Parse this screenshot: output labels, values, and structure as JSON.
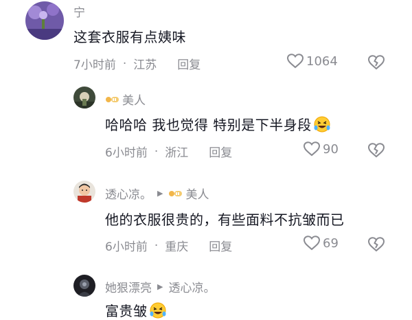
{
  "comments": [
    {
      "username": "宁",
      "text": "这套衣服有点姨味",
      "time": "7小时前",
      "location": "江苏",
      "reply_label": "回复",
      "likes": "1064"
    },
    {
      "username": "美人",
      "text": "哈哈哈 我也觉得 特别是下半身段",
      "time": "6小时前",
      "location": "浙江",
      "reply_label": "回复",
      "likes": "90"
    },
    {
      "username": "透心凉。",
      "reply_to": "美人",
      "text": "他的衣服很贵的，有些面料不抗皱而已",
      "time": "6小时前",
      "location": "重庆",
      "reply_label": "回复",
      "likes": "69"
    },
    {
      "username": "她狠漂亮",
      "reply_to": "透心凉。",
      "text": "富贵皱"
    }
  ],
  "icons": {
    "like": "heart-outline-icon",
    "dislike": "broken-heart-icon",
    "reply_arrow": "triangle-right-icon",
    "emoji": "rofl-emoji-icon"
  },
  "colors": {
    "text": "#161823",
    "secondary": "#8a8b91"
  }
}
